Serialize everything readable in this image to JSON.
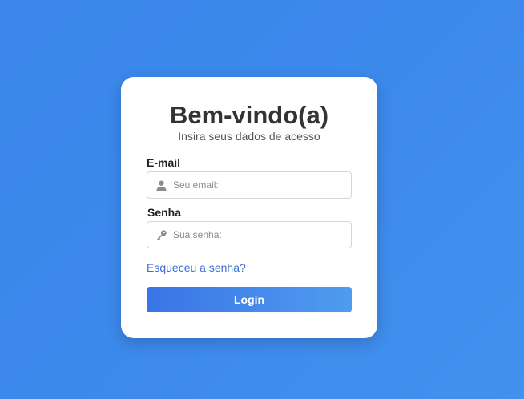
{
  "login": {
    "title": "Bem-vindo(a)",
    "subtitle": "Insira seus dados de acesso",
    "email_label": "E-mail",
    "email_placeholder": "Seu email:",
    "email_value": "",
    "password_label": "Senha",
    "password_placeholder": "Sua senha:",
    "password_value": "",
    "forgot_link": "Esqueceu a senha?",
    "login_button": "Login"
  },
  "icons": {
    "email_field": "user-icon",
    "password_field": "key-icon"
  },
  "colors": {
    "background": "#3c89ec",
    "link": "#3a6fd8",
    "button_start": "#3a74e6",
    "button_end": "#4f9cef"
  }
}
